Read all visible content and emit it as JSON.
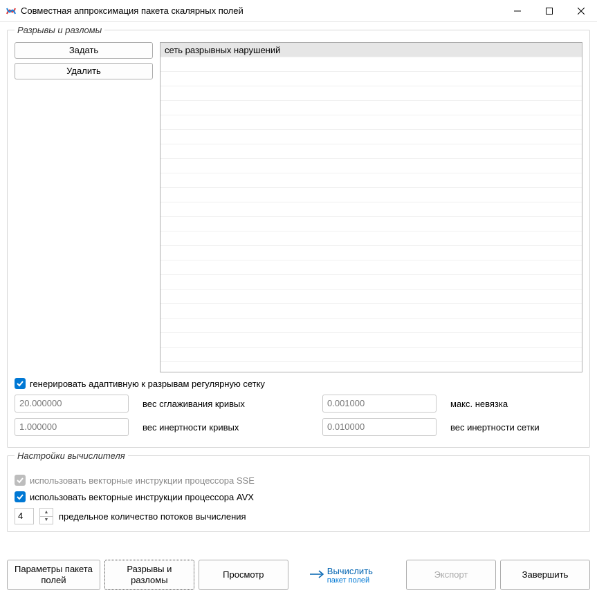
{
  "window": {
    "title": "Совместная аппроксимация пакета скалярных полей"
  },
  "faults": {
    "legend": "Разрывы и разломы",
    "set_btn": "Задать",
    "delete_btn": "Удалить",
    "list_items": {
      "item0": "сеть разрывных нарушений"
    }
  },
  "adaptive_checkbox": {
    "label": "генерировать адаптивную к разрывам регулярную сетку",
    "checked": true
  },
  "params": {
    "smoothing_weight": {
      "value": "20.000000",
      "label": "вес сглаживания кривых"
    },
    "max_residual": {
      "value": "0.001000",
      "label": "макс. невязка"
    },
    "curve_inertia": {
      "value": "1.000000",
      "label": "вес инертности кривых"
    },
    "grid_inertia": {
      "value": "0.010000",
      "label": "вес инертности сетки"
    }
  },
  "computer": {
    "legend": "Настройки вычислителя",
    "sse": {
      "label": "использовать векторные инструкции процессора SSE",
      "checked": true,
      "disabled": true
    },
    "avx": {
      "label": "использовать векторные инструкции процессора AVX",
      "checked": true,
      "disabled": false
    },
    "threads": {
      "value": "4",
      "label": "предельное количество потоков вычисления"
    }
  },
  "bottom": {
    "params_btn_l1": "Параметры пакета",
    "params_btn_l2": "полей",
    "faults_btn_l1": "Разрывы и",
    "faults_btn_l2": "разломы",
    "preview_btn": "Просмотр",
    "compute_btn": "Вычислить",
    "compute_sub": "пакет полей",
    "export_btn": "Экспорт",
    "finish_btn": "Завершить"
  }
}
